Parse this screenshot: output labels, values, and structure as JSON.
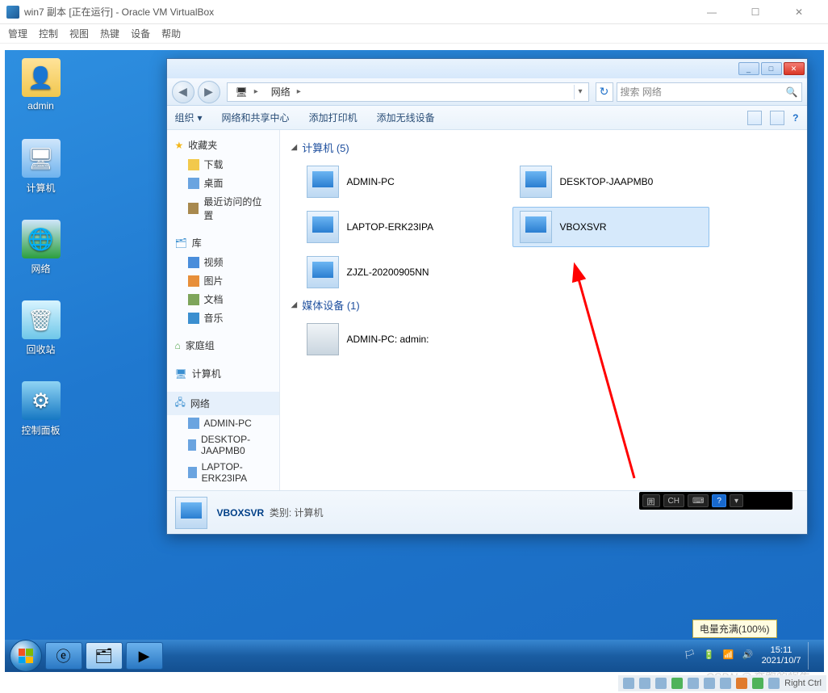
{
  "vbox": {
    "title": "win7 副本 [正在运行] - Oracle VM VirtualBox",
    "menu": [
      "管理",
      "控制",
      "视图",
      "热键",
      "设备",
      "帮助"
    ],
    "host_key": "Right Ctrl"
  },
  "desktop_icons": {
    "admin": "admin",
    "computer": "计算机",
    "network": "网络",
    "recycle": "回收站",
    "control": "控制面板"
  },
  "explorer": {
    "breadcrumb_seg": "网络",
    "search_placeholder": "搜索 网络",
    "toolbar": {
      "organize": "组织",
      "center": "网络和共享中心",
      "printer": "添加打印机",
      "wireless": "添加无线设备"
    },
    "sidebar": {
      "favorites": "收藏夹",
      "fav_items": {
        "downloads": "下载",
        "desktop": "桌面",
        "recent": "最近访问的位置"
      },
      "library": "库",
      "lib_items": {
        "video": "视频",
        "pictures": "图片",
        "docs": "文档",
        "music": "音乐"
      },
      "homegroup": "家庭组",
      "computer": "计算机",
      "network": "网络",
      "net_items": [
        "ADMIN-PC",
        "DESKTOP-JAAPMB0",
        "LAPTOP-ERK23IPA"
      ]
    },
    "groups": {
      "computers_head": "计算机 (5)",
      "computers": [
        "ADMIN-PC",
        "DESKTOP-JAAPMB0",
        "LAPTOP-ERK23IPA",
        "VBOXSVR",
        "ZJZL-20200905NN"
      ],
      "media_head": "媒体设备 (1)",
      "media": [
        "ADMIN-PC: admin:"
      ]
    },
    "status": {
      "name": "VBOXSVR",
      "category_label": "类别:",
      "category": "计算机"
    },
    "ime": "CH"
  },
  "taskbar": {
    "battery_tip": "电量充满(100%)",
    "time": "15:11",
    "date": "2021/10/7"
  },
  "watermark": "CSDN @奔跑的蜗牛"
}
